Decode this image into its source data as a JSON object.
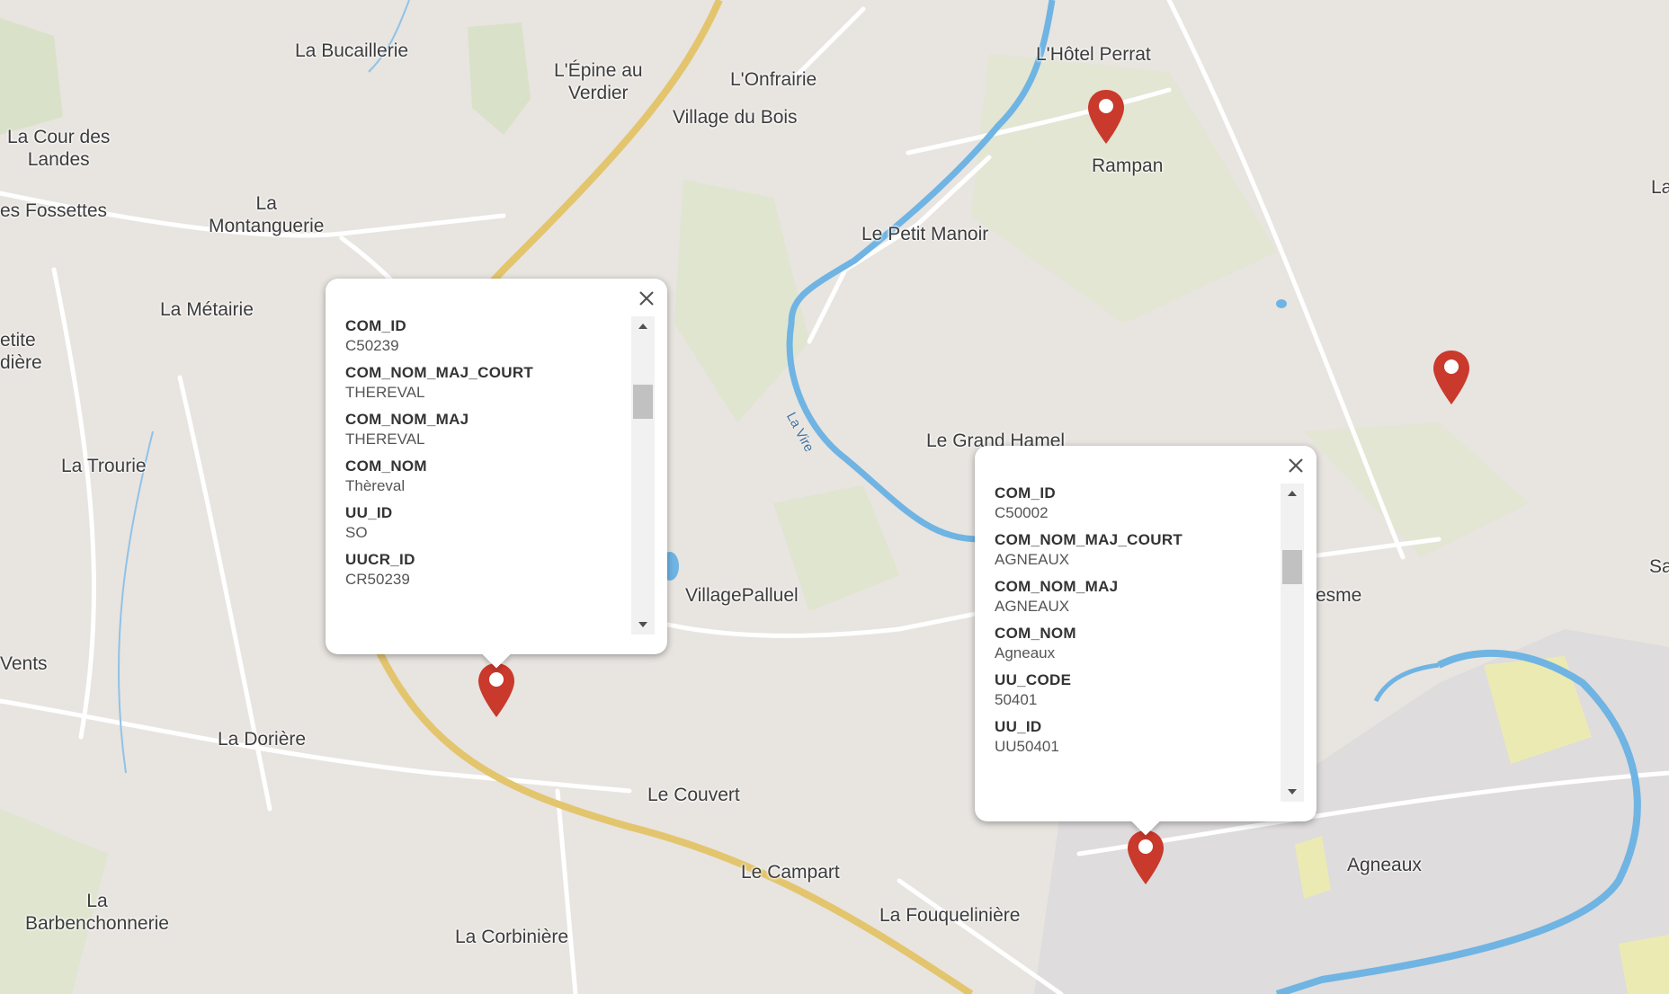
{
  "map": {
    "places": [
      {
        "name": "La Bucaillerie"
      },
      {
        "name": "L'Épine au\nVerdier"
      },
      {
        "name": "L'Onfrairie"
      },
      {
        "name": "Village du Bois"
      },
      {
        "name": "L'Hôtel Perrat"
      },
      {
        "name": "Rampan"
      },
      {
        "name": "La Cour des\nLandes"
      },
      {
        "name": "es Fossettes"
      },
      {
        "name": "La\nMontanguerie"
      },
      {
        "name": "Le Petit Manoir"
      },
      {
        "name": "La Métairie"
      },
      {
        "name": "etite\ndière"
      },
      {
        "name": "La Trourie"
      },
      {
        "name": "Le Grand Hamel"
      },
      {
        "name": "VillagePalluel"
      },
      {
        "name": "resme"
      },
      {
        "name": "Vents"
      },
      {
        "name": "La Dorière"
      },
      {
        "name": "Le Couvert"
      },
      {
        "name": "Le Campart"
      },
      {
        "name": "Agneaux"
      },
      {
        "name": "La\nBarbenchonnerie"
      },
      {
        "name": "La Corbinière"
      },
      {
        "name": "La Fouquelinière"
      },
      {
        "name": "La"
      },
      {
        "name": "Sa"
      }
    ],
    "river_label": "La Vire",
    "colors": {
      "background": "#e8e4e0",
      "road_major": "#e3c56e",
      "road_minor": "#ffffff",
      "water": "#6fb4e3",
      "green": "#d6e0c4",
      "marker": "#c9392c"
    }
  },
  "popups": [
    {
      "fields": [
        {
          "key": "COM_ID",
          "value": "C50239"
        },
        {
          "key": "COM_NOM_MAJ_COURT",
          "value": "THEREVAL"
        },
        {
          "key": "COM_NOM_MAJ",
          "value": "THEREVAL"
        },
        {
          "key": "COM_NOM",
          "value": "Thèreval"
        },
        {
          "key": "UU_ID",
          "value": "SO"
        },
        {
          "key": "UUCR_ID",
          "value": "CR50239"
        }
      ]
    },
    {
      "fields": [
        {
          "key": "COM_ID",
          "value": "C50002"
        },
        {
          "key": "COM_NOM_MAJ_COURT",
          "value": "AGNEAUX"
        },
        {
          "key": "COM_NOM_MAJ",
          "value": "AGNEAUX"
        },
        {
          "key": "COM_NOM",
          "value": "Agneaux"
        },
        {
          "key": "UU_CODE",
          "value": "50401"
        },
        {
          "key": "UU_ID",
          "value": "UU50401"
        }
      ]
    }
  ],
  "icons": {
    "marker": "map-pin-icon",
    "close": "close-icon",
    "scroll_up": "triangle-up-icon",
    "scroll_down": "triangle-down-icon"
  }
}
